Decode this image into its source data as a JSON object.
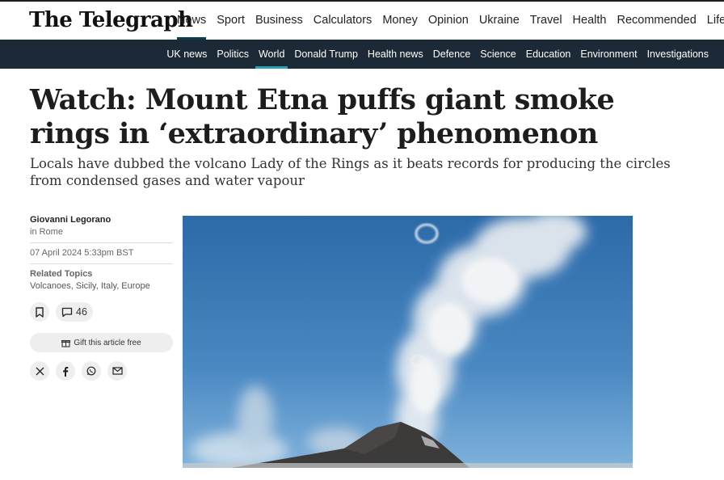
{
  "header": {
    "logo": "The Telegraph",
    "nav": [
      "News",
      "Sport",
      "Business",
      "Calculators",
      "Money",
      "Opinion",
      "Ukraine",
      "Travel",
      "Health",
      "Recommended",
      "Lifestyle"
    ],
    "nav_active": "News"
  },
  "subnav": {
    "items": [
      "UK news",
      "Politics",
      "World",
      "Donald Trump",
      "Health news",
      "Defence",
      "Science",
      "Education",
      "Environment",
      "Investigations"
    ],
    "active": "World"
  },
  "article": {
    "headline": "Watch: Mount Etna puffs giant smoke rings in ‘extraordinary’ phenomenon",
    "standfirst": "Locals have dubbed the volcano Lady of the Rings as it beats records for producing the circles from condensed gases and water vapour",
    "author": "Giovanni Legorano",
    "location": "in Rome",
    "date": "07 April 2024 5:33pm BST",
    "related_title": "Related Topics",
    "related_topics": "Volcanoes, Sicily, Italy, Europe",
    "comment_count": "46",
    "gift_label": "Gift this article free",
    "share_icons": [
      "x-icon",
      "facebook-icon",
      "whatsapp-icon",
      "email-icon"
    ]
  },
  "colors": {
    "subnav_bg": "#1b2a36",
    "active_underline": "#2aa3b0",
    "sky_top": "#2f6fae",
    "sky_bottom": "#6fa6d4"
  }
}
